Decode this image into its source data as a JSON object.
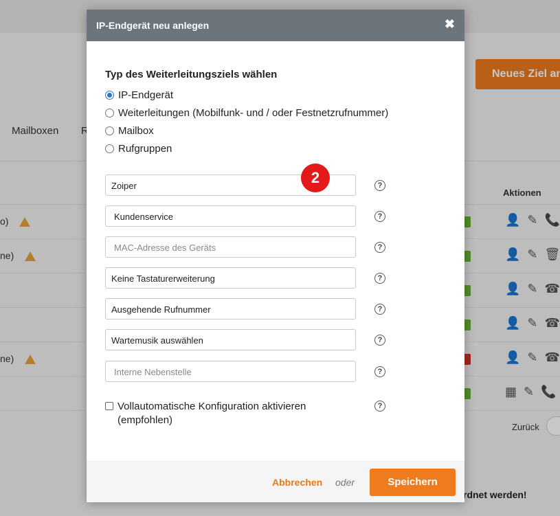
{
  "background": {
    "new_target_button": "Neues Ziel an",
    "tabs": [
      "Mailboxen",
      "R"
    ],
    "table_header_actions": "Aktionen",
    "rows": [
      {
        "text": "o)",
        "warn": true,
        "badge": "green"
      },
      {
        "text": "ne)",
        "warn": true,
        "badge": "green"
      },
      {
        "text": "",
        "warn": false,
        "badge": "green"
      },
      {
        "text": "",
        "warn": false,
        "badge": "green"
      },
      {
        "text": "ne)",
        "warn": true,
        "badge": "red"
      },
      {
        "text": "",
        "warn": false,
        "badge": "green"
      }
    ],
    "pagination_back": "Zurück",
    "bottom_text": "rdnet werden!"
  },
  "modal": {
    "title": "IP-Endgerät neu anlegen",
    "close_symbol": "✖",
    "section_title": "Typ des Weiterleitungsziels wählen",
    "radio_options": [
      {
        "label": "IP-Endgerät",
        "checked": true
      },
      {
        "label": "Weiterleitungen (Mobilfunk- und / oder Festnetzrufnummer)",
        "checked": false
      },
      {
        "label": "Mailbox",
        "checked": false
      },
      {
        "label": "Rufgruppen",
        "checked": false
      }
    ],
    "fields": [
      {
        "value": "Zoiper",
        "placeholder": ""
      },
      {
        "value": "Kundenservice",
        "placeholder": ""
      },
      {
        "value": "",
        "placeholder": "MAC-Adresse des Geräts"
      },
      {
        "value": "Keine Tastaturerweiterung",
        "placeholder": ""
      },
      {
        "value": "Ausgehende Rufnummer",
        "placeholder": ""
      },
      {
        "value": "Wartemusik auswählen",
        "placeholder": ""
      },
      {
        "value": "",
        "placeholder": "Interne Nebenstelle"
      }
    ],
    "help_symbol": "?",
    "step_badge": "2",
    "auto_config_label": "Vollautomatische Konfiguration aktivieren (empfohlen)",
    "auto_config_checked": false,
    "cancel_label": "Abbrechen",
    "or_label": "oder",
    "save_label": "Speichern"
  }
}
